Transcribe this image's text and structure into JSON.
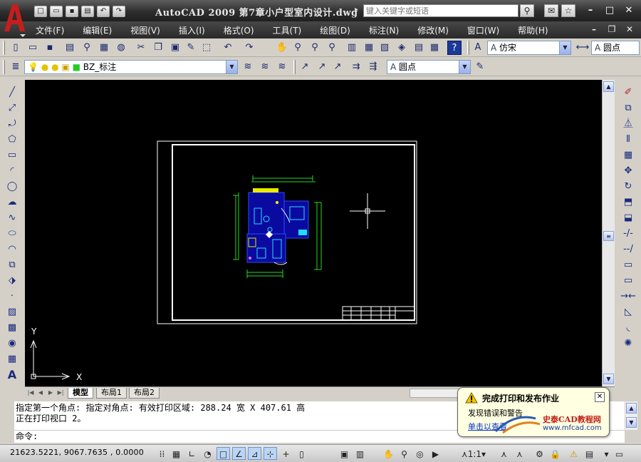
{
  "app": {
    "title": "AutoCAD 2009  第7章小户型室内设计.dwg",
    "search_placeholder": "键入关键字或短语",
    "logo_letter": "A"
  },
  "menu": [
    "文件(F)",
    "编辑(E)",
    "视图(V)",
    "插入(I)",
    "格式(O)",
    "工具(T)",
    "绘图(D)",
    "标注(N)",
    "修改(M)",
    "窗口(W)",
    "帮助(H)"
  ],
  "toolbar": {
    "text_style": "仿宋",
    "dim_style": "圆点",
    "layer": "BZ_标注",
    "multileader_style": "圆点"
  },
  "drawing": {
    "ucs_x": "X",
    "ucs_y": "Y",
    "background": "#000000"
  },
  "layout_tabs": [
    "模型",
    "布局1",
    "布局2"
  ],
  "command": {
    "history": [
      "指定第一个角点: 指定对角点: 有效打印区域:  288.24 宽 X 407.61 高",
      "正在打印视口 2。"
    ],
    "prompt": "命令:"
  },
  "status": {
    "coordinates": "21623.5221, 9067.7635 , 0.0000",
    "annotation_scale": "1:1"
  },
  "notification": {
    "title": "完成打印和发布作业",
    "text": "发现错误和警告",
    "link": "单击以查看"
  },
  "watermark": {
    "name": "史泰CAD教程网",
    "url": "www.mfcad.com"
  },
  "colors": {
    "title_bar": "#2d2d2d",
    "drawing_bg": "#000000",
    "plan_lines": "#1b3cff",
    "dim_lines": "#22dd22",
    "accent_red": "#c41e1e"
  }
}
